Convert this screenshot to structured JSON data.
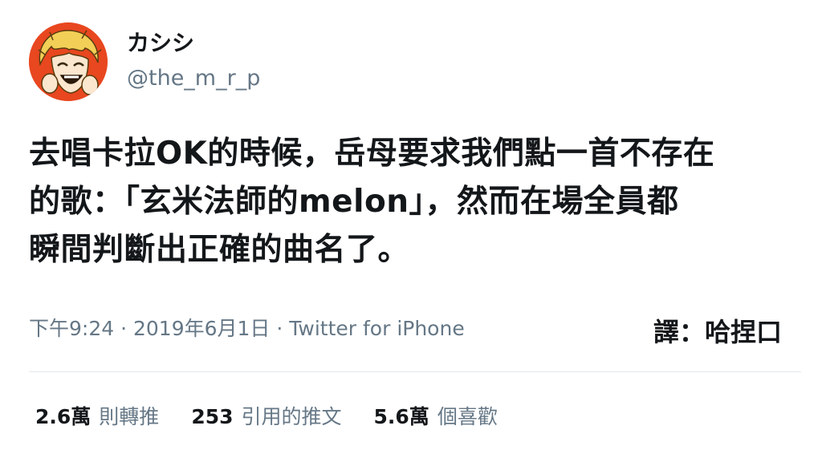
{
  "author": {
    "display_name": "カシシ",
    "handle": "@the_m_r_p",
    "avatar_icon": "anime-character-avatar-icon"
  },
  "tweet": {
    "text": "去唱卡拉OK的時候，岳母要求我們點一首不存在\n的歌：「玄米法師的melon」，然而在場全員都\n瞬間判斷出正確的曲名了。",
    "timestamp": "下午9:24 · 2019年6月1日 · Twitter for iPhone"
  },
  "translator_note": "譯：哈捏口",
  "stats": {
    "retweets": {
      "count": "2.6萬",
      "label": "則轉推"
    },
    "quotes": {
      "count": "253",
      "label": "引用的推文"
    },
    "likes": {
      "count": "5.6萬",
      "label": "個喜歡"
    }
  },
  "colors": {
    "text_primary": "#14171a",
    "text_secondary": "#657786",
    "divider": "#e1e8ed",
    "avatar_bg": "#e8471f"
  }
}
